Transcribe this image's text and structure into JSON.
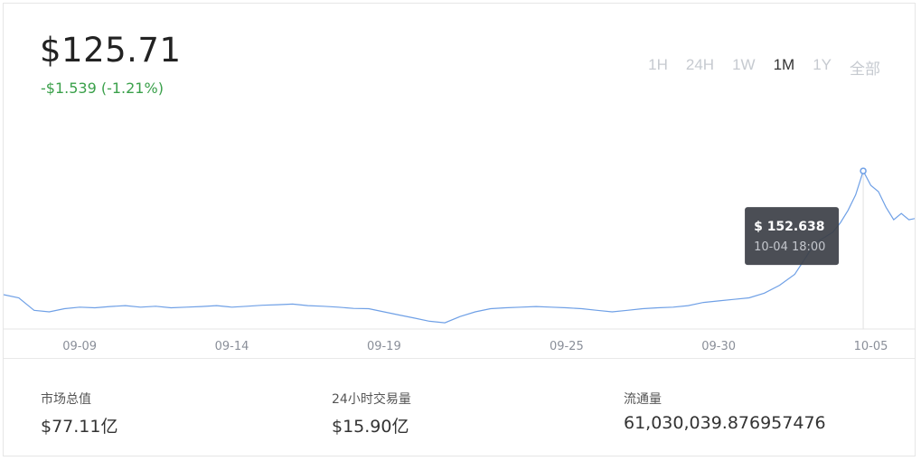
{
  "header": {
    "price": "$125.71",
    "change": "-$1.539 (-1.21%)",
    "change_color": "#3aa04a"
  },
  "ranges": [
    "1H",
    "24H",
    "1W",
    "1M",
    "1Y",
    "全部"
  ],
  "active_range": "1M",
  "tooltip": {
    "value": "$ 152.638",
    "time": "10-04 18:00"
  },
  "stats": [
    {
      "label": "市场总值",
      "value": "$77.11亿"
    },
    {
      "label": "24小时交易量",
      "value": "$15.90亿"
    },
    {
      "label": "流通量",
      "value": "61,030,039.876957476"
    }
  ],
  "chart_data": {
    "type": "line",
    "x_tick_labels": [
      "09-09",
      "09-14",
      "09-19",
      "09-25",
      "09-30",
      "10-05"
    ],
    "line_color": "#6fa0e6",
    "grid": false,
    "x": [
      "09-06 12:00",
      "09-07 00:00",
      "09-07 12:00",
      "09-08 00:00",
      "09-08 12:00",
      "09-09 00:00",
      "09-09 12:00",
      "09-10 00:00",
      "09-10 12:00",
      "09-11 00:00",
      "09-11 12:00",
      "09-12 00:00",
      "09-12 12:00",
      "09-13 00:00",
      "09-13 12:00",
      "09-14 00:00",
      "09-14 12:00",
      "09-15 00:00",
      "09-15 12:00",
      "09-16 00:00",
      "09-16 12:00",
      "09-17 00:00",
      "09-17 12:00",
      "09-18 00:00",
      "09-18 12:00",
      "09-19 00:00",
      "09-19 12:00",
      "09-20 00:00",
      "09-20 12:00",
      "09-21 00:00",
      "09-21 12:00",
      "09-22 00:00",
      "09-22 12:00",
      "09-23 00:00",
      "09-23 12:00",
      "09-24 00:00",
      "09-24 12:00",
      "09-25 00:00",
      "09-25 12:00",
      "09-26 00:00",
      "09-26 12:00",
      "09-27 00:00",
      "09-27 12:00",
      "09-28 00:00",
      "09-28 12:00",
      "09-29 00:00",
      "09-29 12:00",
      "09-30 00:00",
      "09-30 12:00",
      "10-01 00:00",
      "10-01 12:00",
      "10-02 00:00",
      "10-02 12:00",
      "10-03 00:00",
      "10-03 06:00",
      "10-03 12:00",
      "10-03 18:00",
      "10-04 00:00",
      "10-04 06:00",
      "10-04 12:00",
      "10-04 18:00",
      "10-05 00:00",
      "10-05 06:00",
      "10-05 12:00",
      "10-05 18:00",
      "10-06 00:00",
      "10-06 06:00",
      "10-06 12:00"
    ],
    "values": [
      113.0,
      112.0,
      108.0,
      107.5,
      108.5,
      109.0,
      108.8,
      109.2,
      109.5,
      109.0,
      109.3,
      108.8,
      109.0,
      109.2,
      109.5,
      109.0,
      109.3,
      109.6,
      109.8,
      110.0,
      109.5,
      109.3,
      109.0,
      108.6,
      108.5,
      107.5,
      106.5,
      105.5,
      104.5,
      104.0,
      106.0,
      107.5,
      108.5,
      108.8,
      109.0,
      109.2,
      109.0,
      108.8,
      108.5,
      108.0,
      107.5,
      108.0,
      108.5,
      108.8,
      109.0,
      109.5,
      110.5,
      111.0,
      111.5,
      112.0,
      113.5,
      116.0,
      119.5,
      127.0,
      130.0,
      131.5,
      133.0,
      136.0,
      140.0,
      145.0,
      152.6,
      148.0,
      146.0,
      141.0,
      137.0,
      139.0,
      137.0,
      137.5
    ],
    "xlim": [
      "09-06 12:00",
      "10-06 12:00"
    ],
    "ylim": [
      102,
      157
    ],
    "highlight": {
      "x": "10-04 18:00",
      "value": 152.638
    }
  }
}
